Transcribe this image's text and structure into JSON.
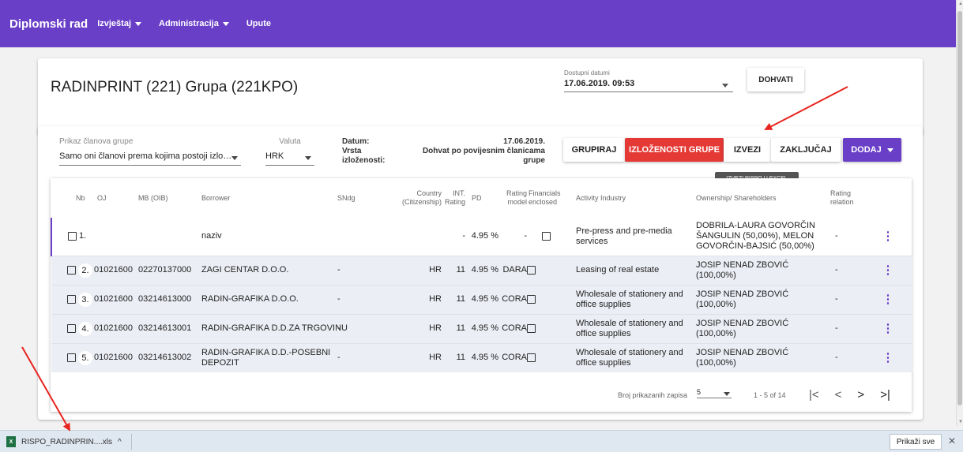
{
  "navbar": {
    "brand": "Diplomski rad",
    "menu": [
      {
        "label": "Izvještaj",
        "dropdown": true
      },
      {
        "label": "Administracija",
        "dropdown": true
      },
      {
        "label": "Upute",
        "dropdown": false
      }
    ]
  },
  "header_card": {
    "title": "RADINPRINT (221) Grupa (221KPO)",
    "dates_label": "Dostupni datumi",
    "dates_value": "17.06.2019. 09:53",
    "fetch_button": "DOHVATI"
  },
  "filters": {
    "members_label": "Prikaz članova grupe",
    "members_value": "Samo oni članovi prema kojima postoji izlo…",
    "currency_label": "Valuta",
    "currency_value": "HRK",
    "date_label": "Datum:",
    "date_value": "17.06.2019.",
    "type_label_1": "Vrsta",
    "type_label_2": "izloženosti:",
    "type_value": "Dohvat po povijesnim članicama grupe"
  },
  "actions": {
    "group": "GRUPIRAJ",
    "exposures": "IZLOŽENOSTI GRUPE",
    "export": "IZVEZI",
    "lock": "ZAKLJUČAJ",
    "add": "DODAJ",
    "tooltip": "IZVEZI RISPO U EXCEL"
  },
  "table": {
    "headers": {
      "nb": "Nb",
      "oj": "OJ",
      "mb": "MB (OIB)",
      "borrower": "Borrower",
      "sndg": "SNdg",
      "country_1": "Country",
      "country_2": "(Citizenship)",
      "int_1": "INT.",
      "int_2": "Rating",
      "pd": "PD",
      "rating_model_1": "Rating",
      "rating_model_2": "model",
      "financials_1": "Financials",
      "financials_2": "enclosed",
      "activity": "Activity Industry",
      "ownership": "Ownership/ Shareholders",
      "relation_1": "Rating",
      "relation_2": "relation"
    },
    "rows": [
      {
        "nb": "1.",
        "oj": "",
        "mb": "",
        "borrower": "naziv",
        "sndg": "",
        "country": "",
        "int": "-",
        "pd": "4.95 %",
        "model": "-",
        "activity": "Pre-press and pre-media services",
        "ownership": "DOBRILA-LAURA GOVORČIN ŠANGULIN (50,00%), MELON GOVORČIN-BAJSIĆ (50,00%)",
        "relation": "-"
      },
      {
        "nb": "2.",
        "oj": "01021600",
        "mb": "02270137000",
        "borrower": "ZAGI CENTAR D.O.O.",
        "sndg": "-",
        "country": "HR",
        "int": "11",
        "pd": "4.95 %",
        "model": "DARA",
        "activity": "Leasing of real estate",
        "ownership": "JOSIP NENAD ZBOVIĆ (100,00%)",
        "relation": "-"
      },
      {
        "nb": "3.",
        "oj": "01021600",
        "mb": "03214613000",
        "borrower": "RADIN-GRAFIKA D.O.O.",
        "sndg": "-",
        "country": "HR",
        "int": "11",
        "pd": "4.95 %",
        "model": "CORA",
        "activity": "Wholesale of stationery and office supplies",
        "ownership": "JOSIP NENAD ZBOVIĆ (100,00%)",
        "relation": "-"
      },
      {
        "nb": "4.",
        "oj": "01021600",
        "mb": "03214613001",
        "borrower": "RADIN-GRAFIKA D.D.ZA TRGOVINU",
        "sndg": "-",
        "country": "HR",
        "int": "11",
        "pd": "4.95 %",
        "model": "CORA",
        "activity": "Wholesale of stationery and office supplies",
        "ownership": "JOSIP NENAD ZBOVIĆ (100,00%)",
        "relation": "-"
      },
      {
        "nb": "5.",
        "oj": "01021600",
        "mb": "03214613002",
        "borrower": "RADIN-GRAFIKA D.D.-POSEBNI DEPOZIT",
        "sndg": "-",
        "country": "HR",
        "int": "11",
        "pd": "4.95 %",
        "model": "CORA",
        "activity": "Wholesale of stationery and office supplies",
        "ownership": "JOSIP NENAD ZBOVIĆ (100,00%)",
        "relation": "-"
      }
    ]
  },
  "pagination": {
    "per_page_label": "Broj prikazanih zapisa",
    "per_page": "5",
    "range": "1 - 5 of 14",
    "first": "|<",
    "prev": "<",
    "next": ">",
    "last": ">|"
  },
  "download_bar": {
    "file_name": "RISPO_RADINPRIN....xls",
    "file_icon_text": "X",
    "expand": "^",
    "show_all": "Prikaži sve",
    "close": "✕"
  },
  "colors": {
    "primary": "#6a3fc8",
    "danger": "#e53935",
    "annotation": "#e8241f"
  }
}
